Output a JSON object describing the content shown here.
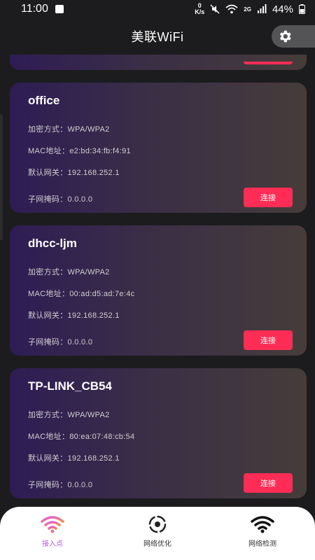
{
  "status_bar": {
    "time": "11:00",
    "speed_value": "0",
    "speed_unit": "K/s",
    "network": "2G",
    "battery": "44%"
  },
  "header": {
    "title": "美联WiFi"
  },
  "networks": [
    {
      "name": "office",
      "encryption": "加密方式：WPA/WPA2",
      "mac": "MAC地址：e2:bd:34:fb:f4:91",
      "gateway": "默认网关：192.168.252.1",
      "subnet": "子网掩码：0.0.0.0",
      "connect_label": "连接"
    },
    {
      "name": "dhcc-ljm",
      "encryption": "加密方式：WPA/WPA2",
      "mac": "MAC地址：00:ad:d5:ad:7e:4c",
      "gateway": "默认网关：192.168.252.1",
      "subnet": "子网掩码：0.0.0.0",
      "connect_label": "连接"
    },
    {
      "name": "TP-LINK_CB54",
      "encryption": "加密方式：WPA/WPA2",
      "mac": "MAC地址：80:ea:07:48:cb:54",
      "gateway": "默认网关：192.168.252.1",
      "subnet": "子网掩码：0.0.0.0",
      "connect_label": "连接"
    }
  ],
  "bottom_nav": [
    {
      "label": "接入点",
      "icon": "wifi-gradient-icon",
      "active": true
    },
    {
      "label": "网络优化",
      "icon": "target-icon",
      "active": false
    },
    {
      "label": "网络检测",
      "icon": "wifi-icon",
      "active": false
    }
  ],
  "colors": {
    "background": "#1c1c1e",
    "card_start": "#2e1c55",
    "card_end": "#463c3a",
    "button": "#ff2d55",
    "active_nav": "#b35ad8"
  }
}
